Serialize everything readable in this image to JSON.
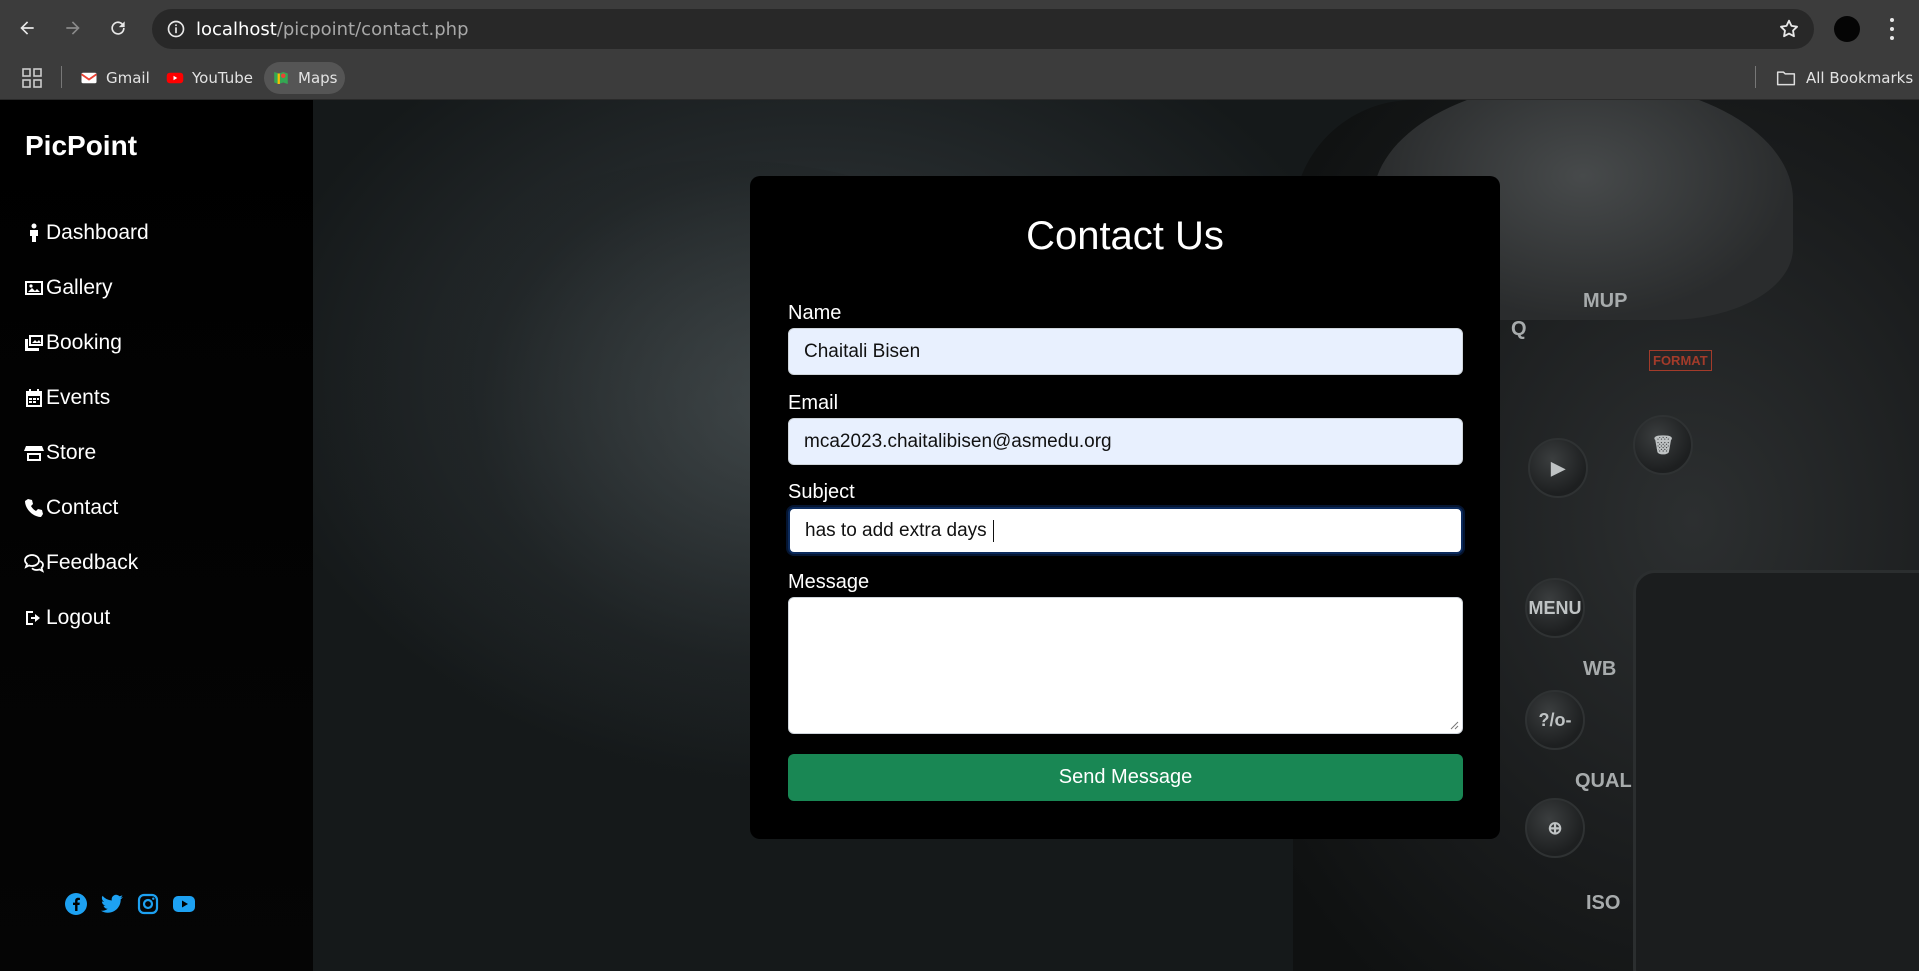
{
  "browser": {
    "url_host": "localhost",
    "url_path": "/picpoint/contact.php",
    "bookmarks": [
      {
        "label": "Gmail",
        "icon": "gmail-icon"
      },
      {
        "label": "YouTube",
        "icon": "youtube-icon"
      },
      {
        "label": "Maps",
        "icon": "maps-icon"
      }
    ],
    "all_bookmarks_label": "All Bookmarks"
  },
  "sidebar": {
    "brand": "PicPoint",
    "items": [
      {
        "label": "Dashboard",
        "icon": "person-icon"
      },
      {
        "label": "Gallery",
        "icon": "image-icon"
      },
      {
        "label": "Booking",
        "icon": "images-icon"
      },
      {
        "label": "Events",
        "icon": "calendar-icon"
      },
      {
        "label": "Store",
        "icon": "store-icon"
      },
      {
        "label": "Contact",
        "icon": "phone-icon"
      },
      {
        "label": "Feedback",
        "icon": "chat-icon"
      },
      {
        "label": "Logout",
        "icon": "logout-icon"
      }
    ],
    "socials": [
      "facebook-icon",
      "twitter-icon",
      "instagram-icon",
      "youtube-icon"
    ],
    "social_color": "#1da1f2"
  },
  "contact": {
    "title": "Contact Us",
    "name_label": "Name",
    "name_value": "Chaitali Bisen",
    "email_label": "Email",
    "email_value": "mca2023.chaitalibisen@asmedu.org",
    "subject_label": "Subject",
    "subject_value": "has to add extra days",
    "message_label": "Message",
    "message_value": "",
    "send_label": "Send Message",
    "send_color": "#198754"
  },
  "camera_labels": {
    "menu": "MENU",
    "wb": "WB",
    "qual": "QUAL",
    "iso": "ISO",
    "format": "FORMAT",
    "q": "Q",
    "mup": "MUP",
    "help": "?/o-"
  }
}
